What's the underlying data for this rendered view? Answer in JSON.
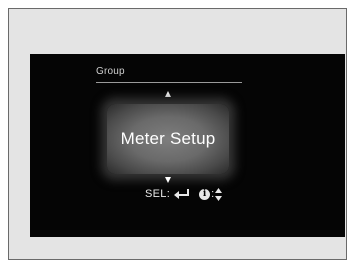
{
  "menu": {
    "title": "Group",
    "selected_item": "Meter Setup"
  },
  "hint": {
    "select_label": "SEL:",
    "info_glyph": "i",
    "colon": ":"
  },
  "icons": {
    "up": "arrow-up-icon",
    "down": "arrow-down-icon",
    "enter": "enter-return-icon",
    "info": "info-icon",
    "scroll": "scroll-up-down-icon"
  },
  "colors": {
    "screen_background": "#050505",
    "frame_background": "#e4e4e4",
    "highlight": "#6a6a6a",
    "text": "#ffffff"
  }
}
